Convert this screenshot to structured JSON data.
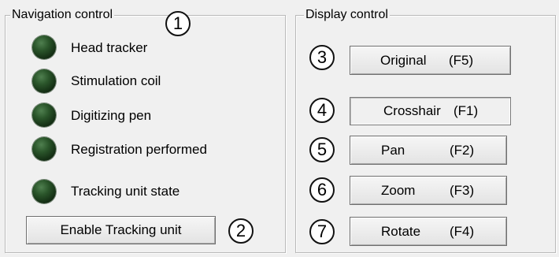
{
  "navigation": {
    "title": "Navigation control",
    "indicators": [
      {
        "label": "Head tracker",
        "state_color": "#1e4a1e"
      },
      {
        "label": "Stimulation coil",
        "state_color": "#1e4a1e"
      },
      {
        "label": "Digitizing pen",
        "state_color": "#1e4a1e"
      },
      {
        "label": "Registration performed",
        "state_color": "#1e4a1e"
      },
      {
        "label": "Tracking unit state",
        "state_color": "#1e4a1e"
      }
    ],
    "enable_button": "Enable Tracking unit"
  },
  "display": {
    "title": "Display control",
    "buttons": [
      {
        "label": "Original",
        "key": "(F5)"
      },
      {
        "label": "Crosshair",
        "key": "(F1)",
        "pressed": true
      },
      {
        "label": "Pan",
        "key": "(F2)"
      },
      {
        "label": "Zoom",
        "key": "(F3)"
      },
      {
        "label": "Rotate",
        "key": "(F4)"
      }
    ]
  },
  "callouts": [
    "1",
    "2",
    "3",
    "4",
    "5",
    "6",
    "7"
  ]
}
